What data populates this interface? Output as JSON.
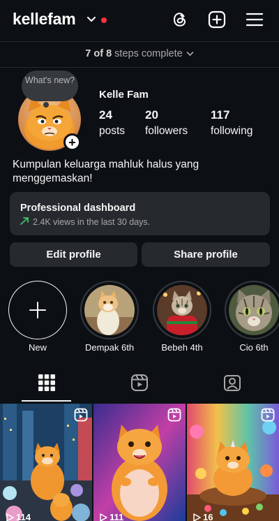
{
  "header": {
    "username": "kellefam",
    "icons": [
      "threads-icon",
      "create-post-icon",
      "menu-icon"
    ]
  },
  "steps": {
    "progress": "7 of 8",
    "label": "steps complete"
  },
  "profile": {
    "note": "What's new?",
    "name": "Kelle Fam",
    "stats": [
      {
        "value": "24",
        "label": "posts"
      },
      {
        "value": "20",
        "label": "followers"
      },
      {
        "value": "117",
        "label": "following"
      }
    ],
    "bio": "Kumpulan keluarga mahluk halus yang menggemaskan!"
  },
  "dashboard": {
    "title": "Professional dashboard",
    "subtitle": "2.4K views in the last 30 days."
  },
  "buttons": {
    "edit": "Edit profile",
    "share": "Share profile"
  },
  "highlights": [
    {
      "label": "New"
    },
    {
      "label": "Dempak 6th"
    },
    {
      "label": "Bebeh 4th"
    },
    {
      "label": "Cio 6th"
    }
  ],
  "tabs": [
    "grid-icon",
    "reels-icon",
    "tagged-icon"
  ],
  "posts": [
    {
      "views": "114"
    },
    {
      "views": "111"
    },
    {
      "views": "16"
    }
  ],
  "colors": {
    "background": "#0c1014",
    "surface": "#262a2e",
    "notification": "#ff3040",
    "trend": "#3ec46d"
  }
}
